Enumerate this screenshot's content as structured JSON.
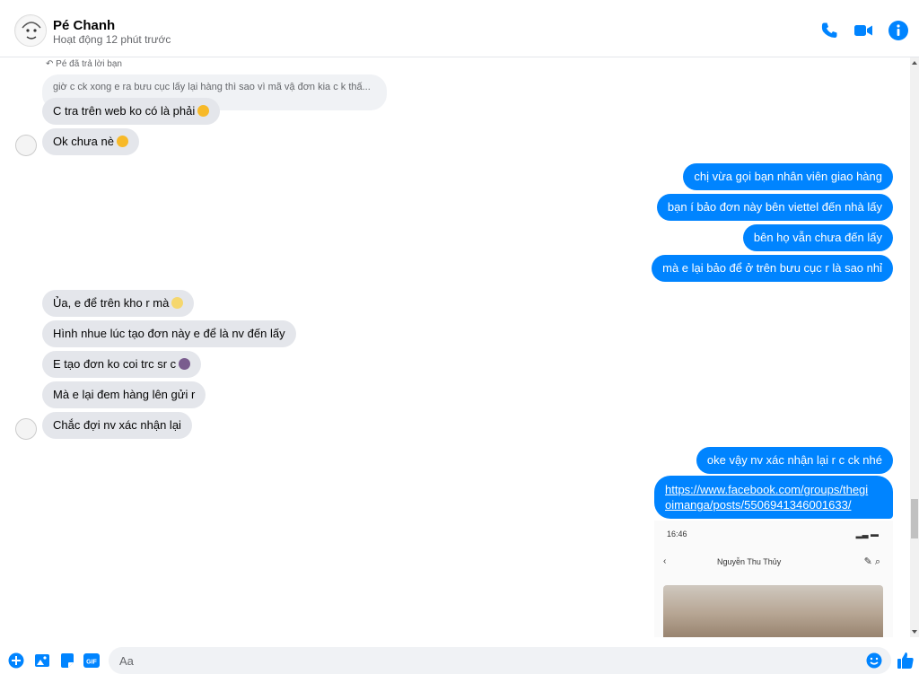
{
  "header": {
    "contact_name": "Pé Chanh",
    "status": "Hoạt động 12 phút trước",
    "icons": [
      "phone-icon",
      "video-icon",
      "info-icon"
    ],
    "accent_color": "#0084ff"
  },
  "messages": {
    "reply_note": "Pé đã trả lời bạn",
    "reply_quote": "giờ c ck xong e ra bưu cục lấy lại hàng thì sao vì mã vậ đơn kia c k thấ...",
    "m1": "C tra trên web ko có là phải",
    "m2": "Ok chưa nè",
    "m3": "chị vừa gọi bạn nhân viên giao hàng",
    "m4": "bạn í bảo đơn này bên viettel đến nhà lấy",
    "m5": "bên họ vẫn chưa đến lấy",
    "m6": "mà e lại bảo để ở trên bưu cục r là sao nhỉ",
    "m7": "Ủa, e để trên kho r mà",
    "m8": "Hình nhue lúc tạo đơn này e để là nv đến lấy",
    "m9": "E tạo đơn ko coi trc sr c",
    "m10": "Mà e lại đem hàng lên gửi r",
    "m11": "Chắc đợi nv xác nhận lại",
    "m12": "oke vậy nv xác nhận lại r c ck nhé",
    "link_line1": "https://www.facebook.com/groups/thegi",
    "link_line2": "oimanga/posts/5506941346001633/"
  },
  "preview": {
    "time": "16:46",
    "name": "Nguyễn Thu Thủy"
  },
  "composer": {
    "placeholder": "Aa",
    "icons": [
      "plus-icon",
      "image-icon",
      "sticker-icon",
      "gif-icon",
      "emoji-icon",
      "like-icon"
    ],
    "gif_label": "GIF"
  }
}
